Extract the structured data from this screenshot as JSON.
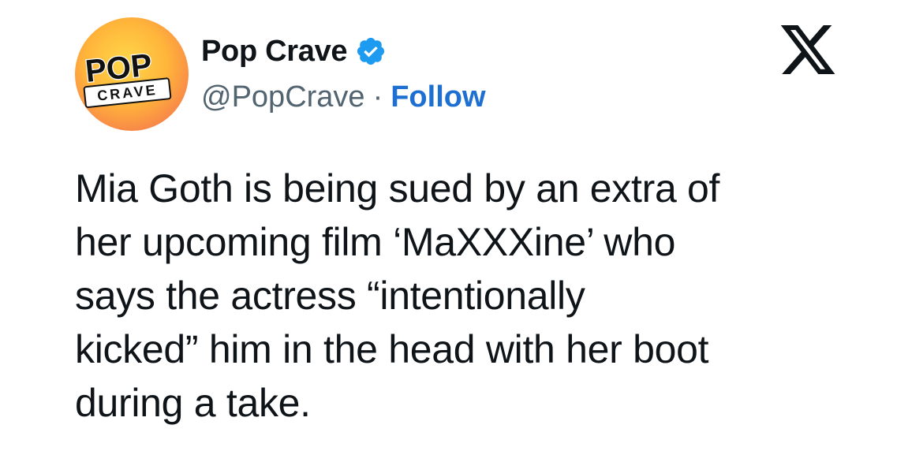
{
  "account": {
    "avatar_text_top": "POP",
    "avatar_text_bottom": "CRAVE",
    "display_name": "Pop Crave",
    "verified": true,
    "handle": "@PopCrave",
    "separator": "·",
    "follow_label": "Follow"
  },
  "platform": {
    "logo": "x-logo-icon"
  },
  "tweet": {
    "text": "Mia Goth is being sued by an extra of\nher upcoming film ‘MaXXXine’ who\nsays the actress “intentionally\nkicked” him in the head with her boot\nduring a take."
  },
  "colors": {
    "text": "#0f1419",
    "muted": "#536471",
    "link": "#1d6fd1",
    "verified_badge": "#1d9bf0",
    "avatar_gradient": [
      "#ffd84a",
      "#ffb43a",
      "#f7834a",
      "#ee6a57"
    ]
  }
}
